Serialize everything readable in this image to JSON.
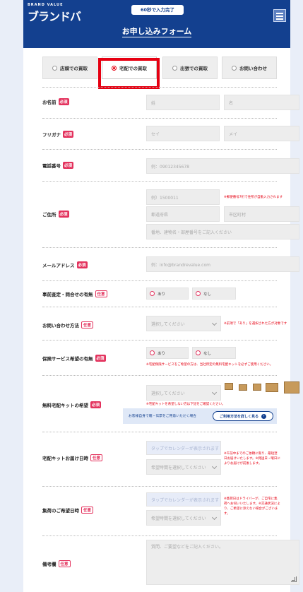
{
  "header": {
    "logo": "ブランドバ",
    "logo_sub": "BRAND VALUE",
    "badge": "60秒で入力完了",
    "title": "お申し込みフォーム",
    "bg_color": "#13408f"
  },
  "tabs": [
    {
      "label": "店頭での買取",
      "selected": false
    },
    {
      "label": "宅配での買取",
      "selected": true
    },
    {
      "label": "出張での買取",
      "selected": false
    },
    {
      "label": "お問い合わせ",
      "selected": false
    }
  ],
  "badges": {
    "required": "必須",
    "optional": "任意"
  },
  "fields": {
    "name": {
      "label": "お名前",
      "last_placeholder": "姓",
      "first_placeholder": "名"
    },
    "furigana": {
      "label": "フリガナ",
      "last_placeholder": "セイ",
      "first_placeholder": "メイ"
    },
    "phone": {
      "label": "電話番号",
      "placeholder": "例：09012345678"
    },
    "address": {
      "label": "ご住所",
      "zip_placeholder": "例）1500011",
      "zip_note": "※郵便番号7桁で住所が自動入力されます",
      "pref_placeholder": "都道府県",
      "city_placeholder": "市区町村",
      "street_placeholder": "番地、建物名・部屋番号をご記入ください"
    },
    "email": {
      "label": "メールアドレス",
      "placeholder": "例：info@brandrevalue.com"
    },
    "assessment": {
      "label": "事前査定・問合せの有無",
      "opt_yes": "あり",
      "opt_no": "なし"
    },
    "contact_method": {
      "label": "お問い合わせ方法",
      "placeholder": "選択してください",
      "note": "※前項で「あり」を選択された方が対象です"
    },
    "insurance": {
      "label": "保険サービス希望の有無",
      "opt_yes": "あり",
      "opt_no": "なし",
      "note": "※宅配保険サービスをご希望の方は、当社所定の無料宅配キットを必ずご使用ください。"
    },
    "kit": {
      "label": "無料宅配キットの希望",
      "placeholder": "選択してください",
      "note": "※宅配キットを希望しない方は下記をご確認ください。",
      "info_text": "お客様自身で箱・伝票をご用意いただく場合",
      "info_button": "ご利用方法を詳しく見る"
    },
    "kit_date": {
      "label": "宅配キットお届け日時",
      "date_placeholder": "タップでカレンダーが表示されます",
      "time_placeholder": "希望時間を選択してください",
      "note": "※午前中までのご依頼に限り、最短翌日お届けいたします。※発送日・曜日によりお届けが前後します。"
    },
    "pickup_date": {
      "label": "集荷のご希望日時",
      "date_placeholder": "タップでカレンダーが表示されます",
      "time_placeholder": "希望時間を選択してください",
      "note": "※集荷日はドライバーが、ご自宅に集荷へお伺いいたします。※交通状況により、ご希望に添えない場合がございます。"
    },
    "remarks": {
      "label": "備考欄",
      "placeholder": "質問、ご要望などをご記入ください。"
    }
  }
}
